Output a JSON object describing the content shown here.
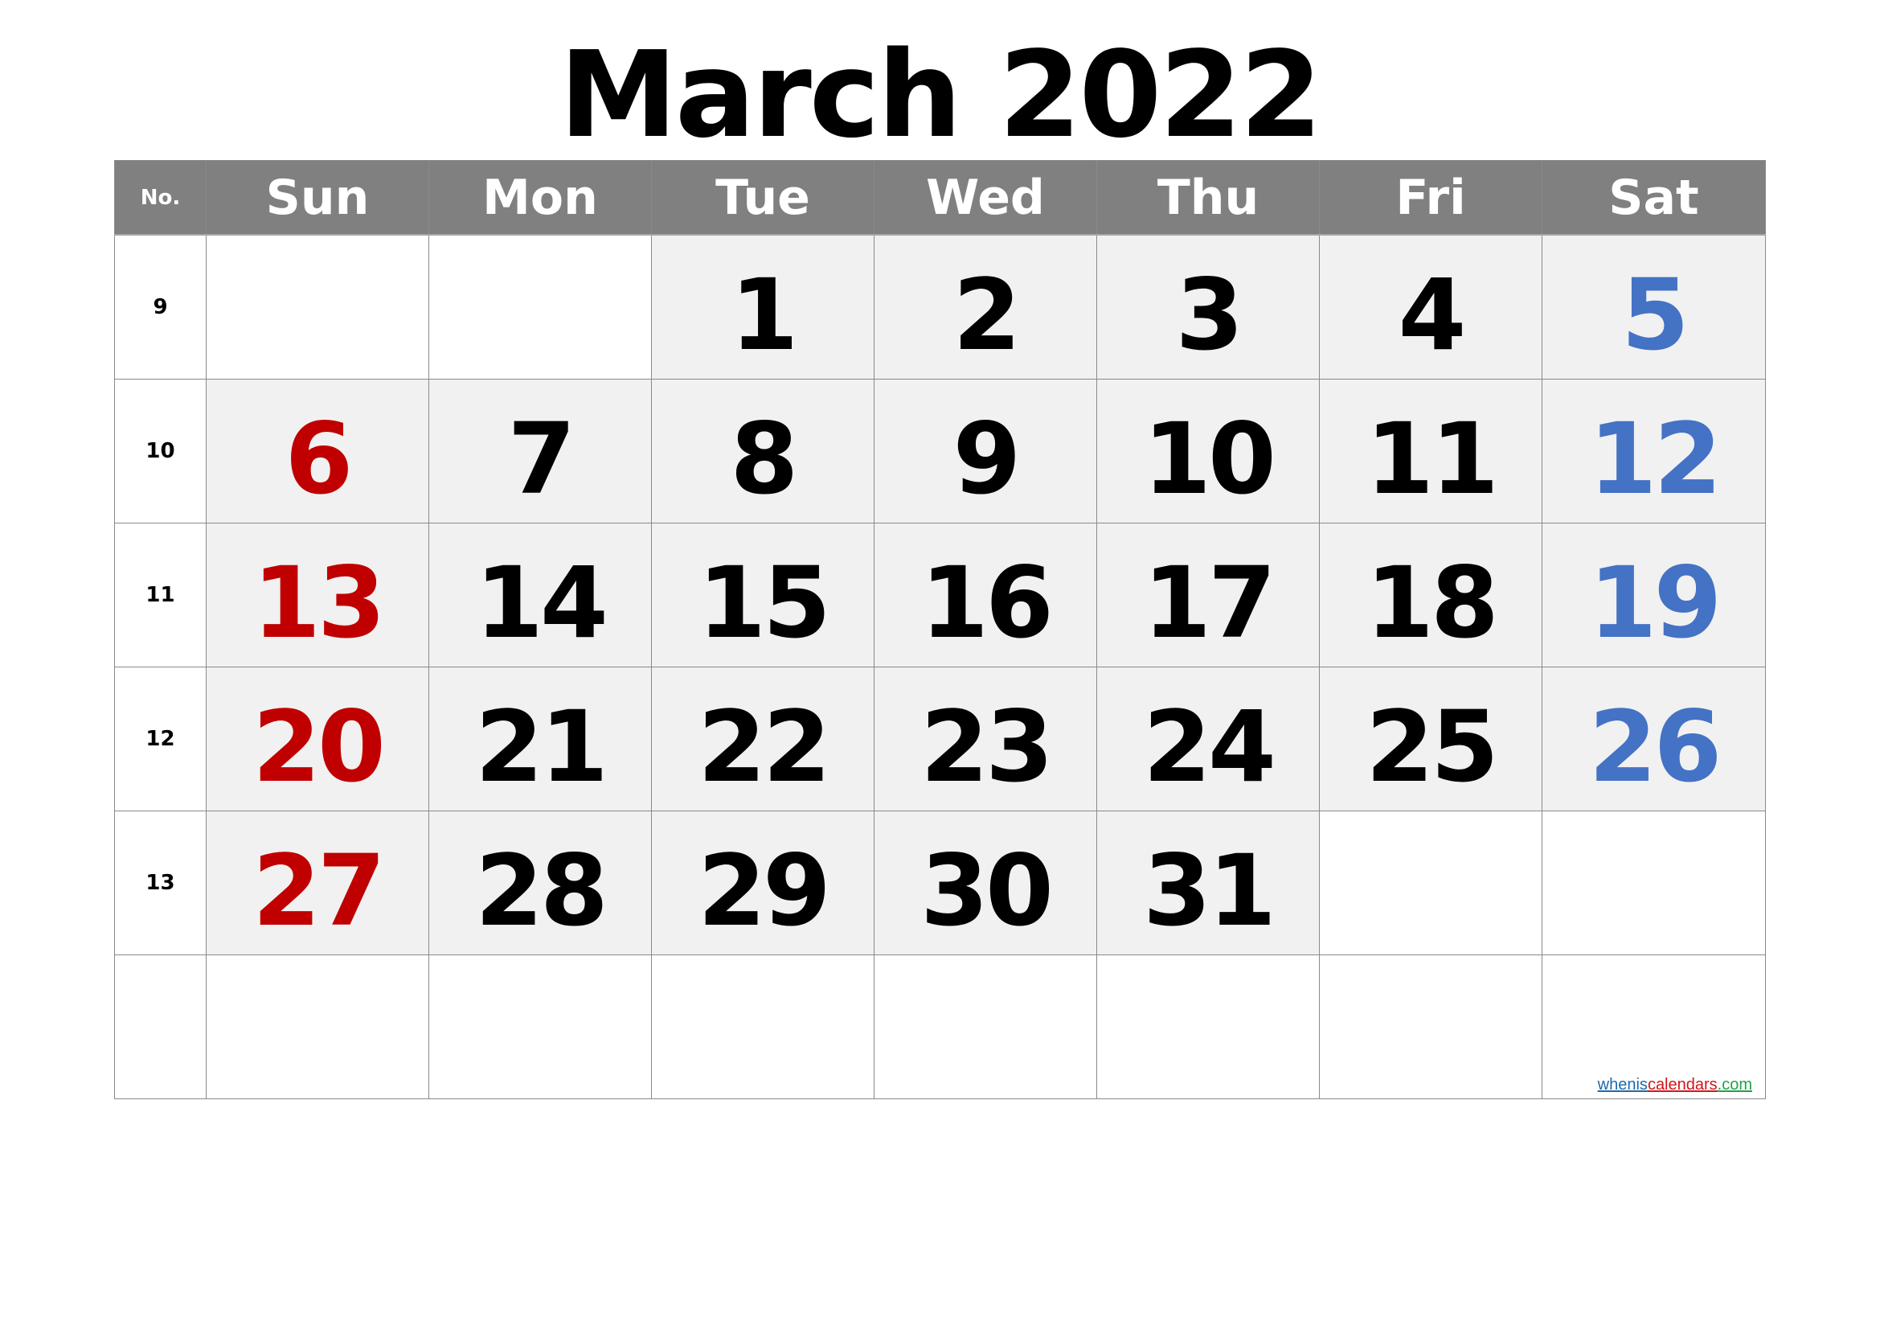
{
  "title": "March 2022",
  "colors": {
    "header_bg": "#808080",
    "header_text": "#FFFFFF",
    "in_month_cell_bg": "#F1F1F1",
    "sunday": "#C00000",
    "saturday": "#4472C4",
    "weekday": "#000000"
  },
  "header": {
    "week_no_label": "No.",
    "days": [
      "Sun",
      "Mon",
      "Tue",
      "Wed",
      "Thu",
      "Fri",
      "Sat"
    ]
  },
  "weeks": [
    {
      "no": "9",
      "days": [
        "",
        "",
        "1",
        "2",
        "3",
        "4",
        "5"
      ]
    },
    {
      "no": "10",
      "days": [
        "6",
        "7",
        "8",
        "9",
        "10",
        "11",
        "12"
      ]
    },
    {
      "no": "11",
      "days": [
        "13",
        "14",
        "15",
        "16",
        "17",
        "18",
        "19"
      ]
    },
    {
      "no": "12",
      "days": [
        "20",
        "21",
        "22",
        "23",
        "24",
        "25",
        "26"
      ]
    },
    {
      "no": "13",
      "days": [
        "27",
        "28",
        "29",
        "30",
        "31",
        "",
        ""
      ]
    },
    {
      "no": "",
      "days": [
        "",
        "",
        "",
        "",
        "",
        "",
        ""
      ]
    }
  ],
  "watermark": {
    "part1": "whenis",
    "part2": "calendars",
    "part3": ".com"
  }
}
